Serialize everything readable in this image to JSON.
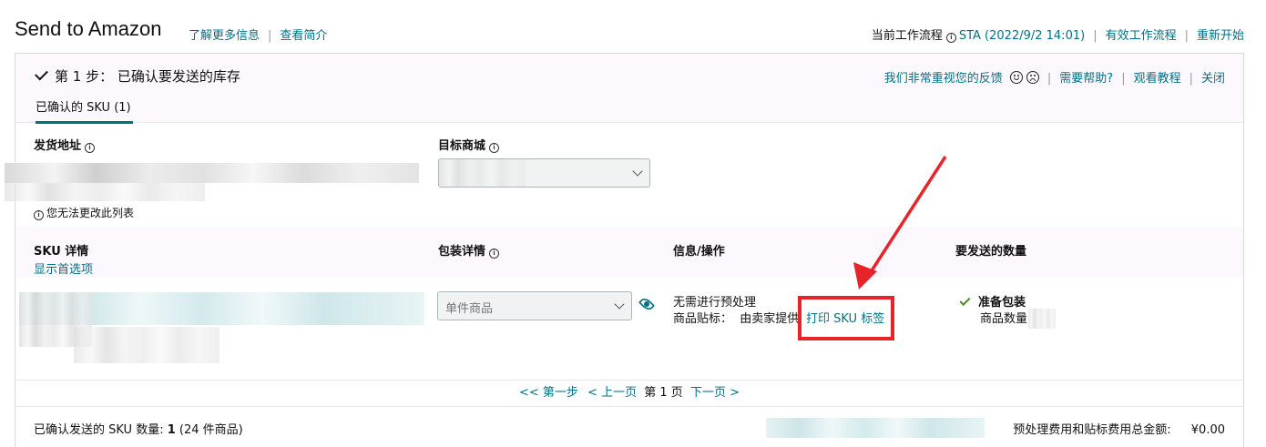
{
  "header": {
    "title": "Send to Amazon",
    "link_learn_more": "了解更多信息",
    "link_view_intro": "查看简介",
    "workflow_label": "当前工作流程",
    "workflow_value": "STA (2022/9/2 14:01)",
    "link_active_workflows": "有效工作流程",
    "link_restart": "重新开始"
  },
  "step": {
    "title": "第 1 步： 已确认要发送的库存",
    "feedback": "我们非常重视您的反馈",
    "help": "需要帮助?",
    "tutorial": "观看教程",
    "close": "关闭",
    "tab_label": "已确认的 SKU (1)"
  },
  "ship_from": {
    "label": "发货地址",
    "note": "您无法更改此列表"
  },
  "marketplace": {
    "label": "目标商城"
  },
  "sku_table": {
    "col_sku": "SKU 详情",
    "show_prefs": "显示首选项",
    "col_packing": "包装详情",
    "col_info": "信息/操作",
    "col_qty": "要发送的数量",
    "packing_select": "单件商品",
    "prep_text": "无需进行预处理",
    "label_text": "商品贴标：  由卖家提供",
    "print_link": "打印 SKU 标签",
    "ready_pack": "准备包装",
    "qty_label": "商品数量"
  },
  "pager": {
    "first": "<< 第一步",
    "prev": "< 上一页",
    "current": "第 1 页",
    "next": "下一页 >"
  },
  "footer": {
    "confirmed_label": "已确认发送的 SKU 数量:",
    "confirmed_count": "1",
    "confirmed_items": "(24 件商品)",
    "fee_label": "预处理费用和贴标费用总金额:",
    "fee_value": "¥0.00"
  },
  "colors": {
    "link": "#007185",
    "highlight": "#e8242b",
    "check_green": "#4a8c1c"
  }
}
